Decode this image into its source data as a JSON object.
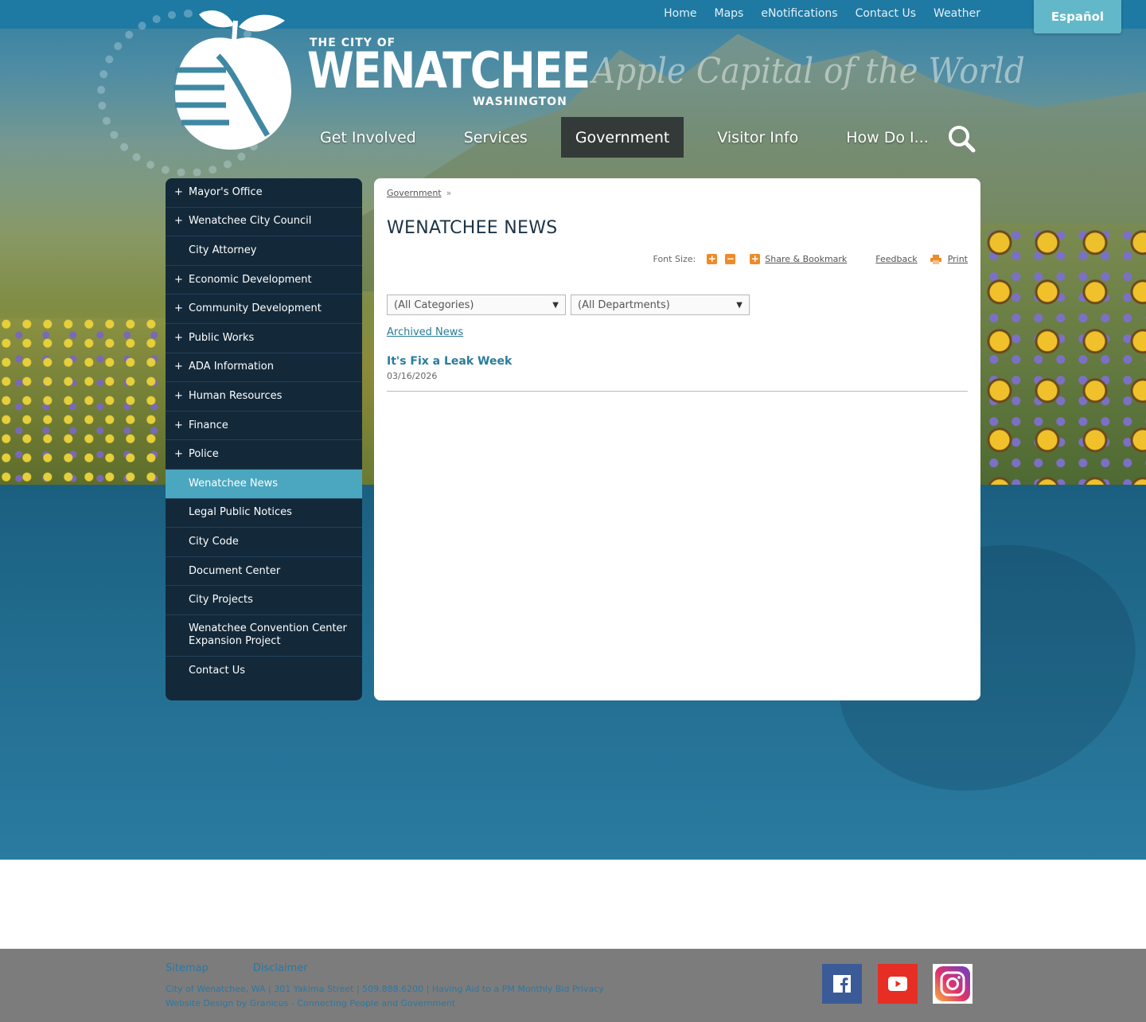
{
  "utility": {
    "links": [
      "Home",
      "Maps",
      "eNotifications",
      "Contact Us",
      "Weather"
    ],
    "language_button": "Español"
  },
  "logo": {
    "line1": "THE CITY OF",
    "line2": "WENATCHEE",
    "line3": "WASHINGTON",
    "tagline": "Apple Capital of the World"
  },
  "nav": {
    "items": [
      "Get Involved",
      "Services",
      "Government",
      "Visitor Info",
      "How Do I..."
    ],
    "active": "Government",
    "search_icon": "search-icon"
  },
  "sidebar": {
    "items": [
      {
        "label": "Mayor's Office",
        "expandable": "+"
      },
      {
        "label": "Wenatchee City Council",
        "expandable": "+"
      },
      {
        "label": "City Attorney",
        "expandable": ""
      },
      {
        "label": "Economic Development",
        "expandable": "+"
      },
      {
        "label": "Community Development",
        "expandable": "+"
      },
      {
        "label": "Public Works",
        "expandable": "+"
      },
      {
        "label": "ADA Information",
        "expandable": "+"
      },
      {
        "label": "Human Resources",
        "expandable": "+"
      },
      {
        "label": "Finance",
        "expandable": "+"
      },
      {
        "label": "Police",
        "expandable": "+"
      },
      {
        "label": "Wenatchee News",
        "expandable": ""
      },
      {
        "label": "Legal Public Notices",
        "expandable": ""
      },
      {
        "label": "City Code",
        "expandable": ""
      },
      {
        "label": "Document Center",
        "expandable": ""
      },
      {
        "label": "City Projects",
        "expandable": ""
      },
      {
        "label": "Wenatchee Convention Center Expansion Project",
        "expandable": ""
      },
      {
        "label": "Contact Us",
        "expandable": ""
      }
    ],
    "active_index": 10
  },
  "content": {
    "breadcrumb": "Government",
    "breadcrumb_sep": "»",
    "title": "WENATCHEE NEWS",
    "tools": {
      "font_size_label": "Font Size:",
      "increase": "+",
      "decrease": "−",
      "share_icon": "+",
      "share": "Share & Bookmark",
      "feedback": "Feedback",
      "print": "Print"
    },
    "filters": {
      "category": "(All Categories)",
      "department": "(All Departments)"
    },
    "archived_link": "Archived News",
    "news": [
      {
        "title": "It's Fix a Leak Week",
        "date": "03/16/2026"
      }
    ]
  },
  "footer": {
    "links": [
      "Sitemap",
      "Disclaimer"
    ],
    "line1": "City of Wenatchee, WA | 301 Yakima Street | 509.888.6200 | Having Aid to a PM Monthly Bid Privacy",
    "line2": "Website Design by Granicus - Connecting People and Government",
    "social": [
      "facebook-icon",
      "youtube-icon",
      "instagram-icon"
    ]
  },
  "colors": {
    "accent": "#4ba7bf",
    "sidebar": "#13293a",
    "link": "#2a7d9a",
    "tool_orange": "#ee8b28"
  }
}
